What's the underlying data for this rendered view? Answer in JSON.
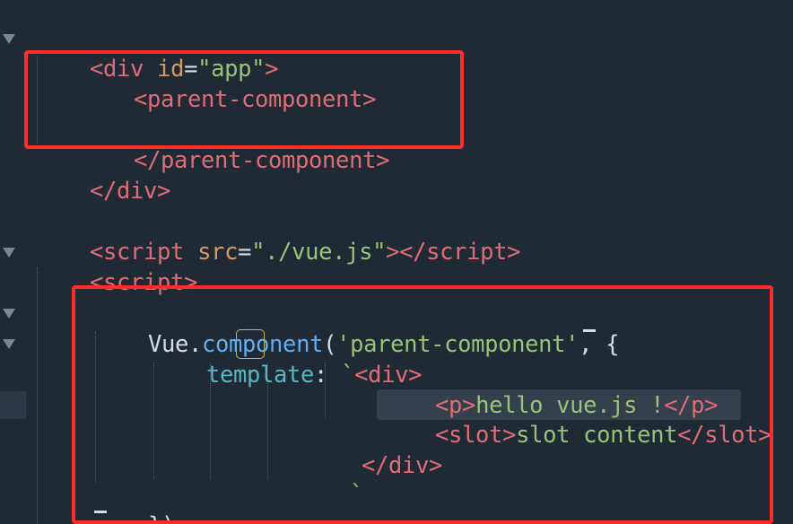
{
  "code": {
    "l1": {
      "open": "<",
      "tag": "div",
      "sp": " ",
      "attr": "id",
      "eq": "=",
      "val": "\"app\"",
      "close": ">"
    },
    "l2": {
      "open": "<",
      "tag": "parent-component",
      "close": ">"
    },
    "l3": {
      "open": "</",
      "tag": "parent-component",
      "close": ">"
    },
    "l4": {
      "open": "</",
      "tag": "div",
      "close": ">"
    },
    "l5": {
      "open": "<",
      "tag": "script",
      "sp": " ",
      "attr": "src",
      "eq": "=",
      "val": "\"./vue.js\"",
      "mid": "></",
      "tag2": "script",
      "close": ">"
    },
    "l6": {
      "open": "<",
      "tag": "script",
      "close": ">"
    },
    "l7": {
      "obj": "Vue",
      "dot": ".",
      "method": "component",
      "paren": "(",
      "str": "'parent-component'",
      "rest": ", {"
    },
    "l8": {
      "prop": "template",
      "colon": ":",
      "tick": "`",
      "open": "<",
      "tag": "div",
      "close": ">"
    },
    "l9": {
      "open1": "<",
      "tag1": "p",
      "close1": ">",
      "text": "hello vue.js !",
      "open2": "</",
      "tag2": "p",
      "close2": ">"
    },
    "l10": {
      "open1": "<",
      "tag1": "slot",
      "close1": ">",
      "text": "slot content",
      "open2": "</",
      "tag2": "slot",
      "close2": ">"
    },
    "l11": {
      "open": "</",
      "tag": "div",
      "close": ">"
    },
    "l12": {
      "tick": "`"
    },
    "l13": {
      "text": "});"
    }
  },
  "colors": {
    "background": "#1f2a35",
    "tag": "#e06c75",
    "attribute": "#d19a66",
    "string": "#98c379",
    "method": "#61afef",
    "property": "#56b6c2",
    "annotation_box": "#ff2d2a",
    "bracket_match": "#d9b43f"
  },
  "icons": [
    "fold-arrow-icon"
  ]
}
